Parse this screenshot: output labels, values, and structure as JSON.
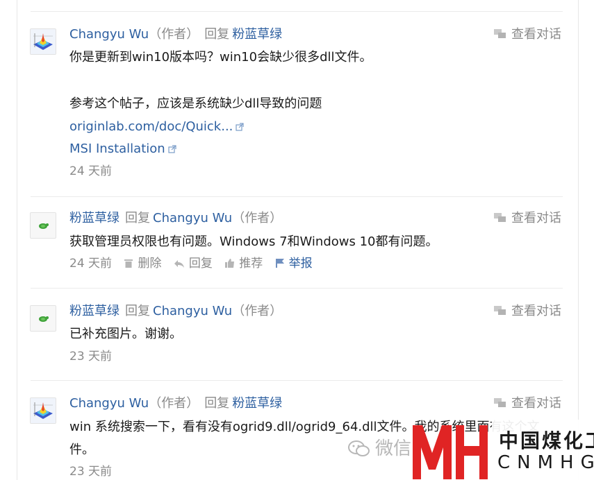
{
  "comments": [
    {
      "author": "Changyu Wu",
      "author_tag": "作者",
      "reply_word": "回复",
      "reply_to": "粉蓝草绿",
      "reply_to_tag": "",
      "view_conversation": "查看对话",
      "lines": [
        "你是更新到win10版本吗？win10会缺少很多dll文件。",
        "参考这个帖子，应该是系统缺少dll导致的问题"
      ],
      "links": [
        "originlab.com/doc/Quick...",
        "MSI Installation"
      ],
      "time": "24 天前",
      "avatar_icon": "surface-plot-avatar-icon"
    },
    {
      "author": "粉蓝草绿",
      "author_tag": "",
      "reply_word": "回复",
      "reply_to": "Changyu Wu",
      "reply_to_tag": "作者",
      "view_conversation": "查看对话",
      "lines": [
        "获取管理员权限也有问题。Windows 7和Windows 10都有问题。"
      ],
      "time": "24 天前",
      "actions": {
        "delete": "删除",
        "reply": "回复",
        "recommend": "推荐",
        "report": "举报"
      },
      "avatar_icon": "green-turtle-avatar-icon"
    },
    {
      "author": "粉蓝草绿",
      "author_tag": "",
      "reply_word": "回复",
      "reply_to": "Changyu Wu",
      "reply_to_tag": "作者",
      "view_conversation": "查看对话",
      "lines": [
        "已补充图片。谢谢。"
      ],
      "time": "23 天前",
      "avatar_icon": "green-turtle-avatar-icon"
    },
    {
      "author": "Changyu Wu",
      "author_tag": "作者",
      "reply_word": "回复",
      "reply_to": "粉蓝草绿",
      "reply_to_tag": "",
      "view_conversation": "查看对话",
      "lines": [
        "win 系统搜索一下，看有没有ogrid9.dll/ogrid9_64.dll文件。我的系统里面有这个文",
        "件。"
      ],
      "time": "23 天前",
      "avatar_icon": "surface-plot-avatar-icon"
    }
  ],
  "watermark": {
    "wechat": "微信",
    "brand_cn": "中国煤化工",
    "brand_en": "CNMHG",
    "logo_color": "#e02424"
  },
  "colors": {
    "link": "#2d5fa0",
    "muted": "#8a8a8a",
    "text": "#1a1a1a"
  }
}
